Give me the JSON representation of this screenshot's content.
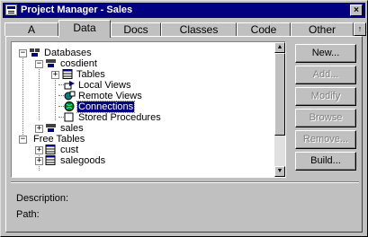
{
  "window": {
    "title": "Project Manager - Sales",
    "close_glyph": "×"
  },
  "tabs": [
    {
      "label": "A",
      "active": false
    },
    {
      "label": "Data",
      "active": true
    },
    {
      "label": "Docs",
      "active": false
    },
    {
      "label": "Classes",
      "active": false
    },
    {
      "label": "Code",
      "active": false
    },
    {
      "label": "Other",
      "active": false
    }
  ],
  "tab_scroll_glyph": "↑",
  "tree": {
    "items": [
      {
        "label": "Databases",
        "level": 0,
        "expander": "−",
        "icon": "databases-icon"
      },
      {
        "label": "cosdient",
        "level": 1,
        "expander": "−",
        "icon": "database-icon"
      },
      {
        "label": "Tables",
        "level": 2,
        "expander": "+",
        "icon": "tables-icon"
      },
      {
        "label": "Local Views",
        "level": 2,
        "expander": "",
        "icon": "local-views-icon"
      },
      {
        "label": "Remote Views",
        "level": 2,
        "expander": "",
        "icon": "remote-views-icon"
      },
      {
        "label": "Connections",
        "level": 2,
        "expander": "",
        "icon": "connections-icon",
        "selected": true
      },
      {
        "label": "Stored Procedures",
        "level": 2,
        "expander": "",
        "icon": "stored-procedures-icon"
      },
      {
        "label": "sales",
        "level": 1,
        "expander": "+",
        "icon": "database-icon"
      },
      {
        "label": "Free Tables",
        "level": 0,
        "expander": "−",
        "icon": "free-tables-icon"
      },
      {
        "label": "cust",
        "level": 1,
        "expander": "+",
        "icon": "table-icon"
      },
      {
        "label": "salegoods",
        "level": 1,
        "expander": "+",
        "icon": "table-icon"
      }
    ]
  },
  "scrollbar": {
    "up_glyph": "▲",
    "down_glyph": "▼"
  },
  "buttons": [
    {
      "label": "New...",
      "enabled": true
    },
    {
      "label": "Add...",
      "enabled": false
    },
    {
      "label": "Modify",
      "enabled": false
    },
    {
      "label": "Browse",
      "enabled": false
    },
    {
      "label": "Remove...",
      "enabled": false
    },
    {
      "label": "Build...",
      "enabled": true
    }
  ],
  "details": {
    "description_label": "Description:",
    "path_label": "Path:"
  },
  "colors": {
    "title_bar": "#000080",
    "selection": "#000080",
    "face": "#c0c0c0"
  }
}
